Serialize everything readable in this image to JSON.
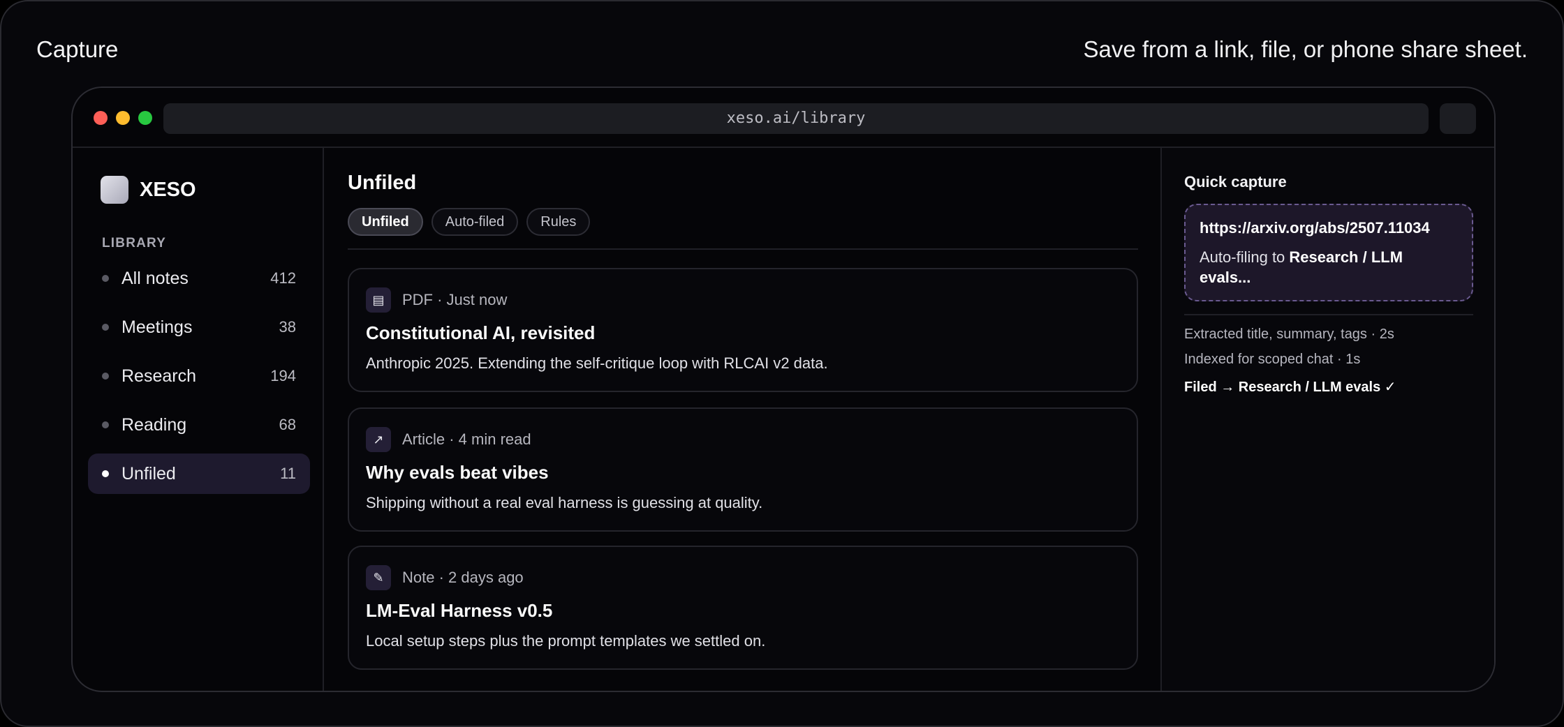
{
  "header": {
    "left": "Capture",
    "right": "Save from a link, file, or phone share sheet."
  },
  "browser": {
    "url": "xeso.ai/library"
  },
  "sidebar": {
    "brand": "XESO",
    "section_label": "LIBRARY",
    "items": [
      {
        "label": "All notes",
        "count": "412"
      },
      {
        "label": "Meetings",
        "count": "38"
      },
      {
        "label": "Research",
        "count": "194"
      },
      {
        "label": "Reading",
        "count": "68"
      },
      {
        "label": "Unfiled",
        "count": "11",
        "active": true
      }
    ]
  },
  "main": {
    "title": "Unfiled",
    "tabs": [
      {
        "label": "Unfiled",
        "active": true
      },
      {
        "label": "Auto-filed"
      },
      {
        "label": "Rules"
      }
    ],
    "cards": [
      {
        "icon": "document-icon",
        "glyph": "▤",
        "meta": "PDF · Just now",
        "title": "Constitutional AI, revisited",
        "desc": "Anthropic 2025. Extending the self-critique loop with RLCAI v2 data."
      },
      {
        "icon": "link-arrow-icon",
        "glyph": "↗",
        "meta": "Article · 4 min read",
        "title": "Why evals beat vibes",
        "desc": "Shipping without a real eval harness is guessing at quality."
      },
      {
        "icon": "pencil-icon",
        "glyph": "✎",
        "meta": "Note · 2 days ago",
        "title": "LM-Eval Harness v0.5",
        "desc": "Local setup steps plus the prompt templates we settled on."
      }
    ]
  },
  "quick_capture": {
    "title": "Quick capture",
    "url": "https://arxiv.org/abs/2507.11034",
    "status_prefix": "Auto-filing to",
    "status_target": "Research / LLM evals...",
    "log": [
      "Extracted title, summary, tags · 2s",
      "Indexed for scoped chat · 1s",
      "Filed → Research / LLM evals ✓"
    ]
  },
  "colors": {
    "accent_surface": "#1e1a2e",
    "dashed_border": "#6a5a90",
    "dot_red": "#fe5f57",
    "dot_yellow": "#febc2e",
    "dot_green": "#28c840"
  }
}
